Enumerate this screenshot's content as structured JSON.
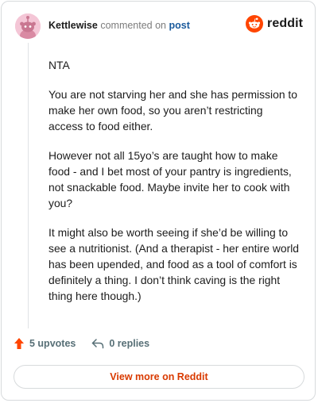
{
  "comment": {
    "username": "Kettlewise",
    "commented_on": "commented on",
    "post_link": "post",
    "paragraphs": [
      "NTA",
      "You are not starving her and she has permission to make her own food, so you aren’t restricting access to food either.",
      "However not all 15yo’s are taught how to make food - and I bet most of your pantry is ingredients, not snackable food. Maybe invite her to cook with you?",
      "It might also be worth seeing if she’d be willing to see a nutritionist. (And a therapist - her entire world has been upended, and food as a tool of comfort is definitely a thing. I don’t think caving is the right thing here though.)"
    ]
  },
  "brand": {
    "name": "reddit",
    "color": "#ff4500"
  },
  "actions": {
    "upvotes_label": "5 upvotes",
    "replies_label": "0 replies"
  },
  "footer": {
    "view_more_label": "View more on Reddit"
  },
  "colors": {
    "upvote_active": "#ff4500",
    "link": "#1a5a9c",
    "view_more": "#d93a00"
  }
}
